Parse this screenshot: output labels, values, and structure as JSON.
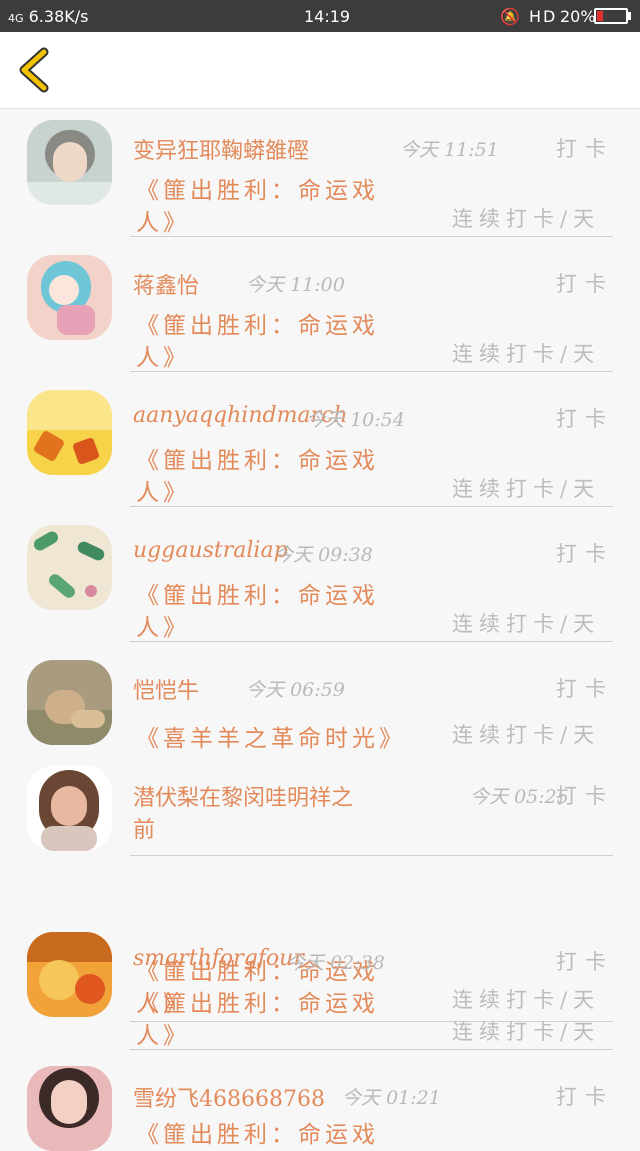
{
  "status_bar": {
    "signal": "4G",
    "speed": "6.38K/s",
    "time": "14:19",
    "icons": "🔕 HD",
    "battery": "20%",
    "battery_level": 0.2,
    "battery_color": "#e0312d"
  },
  "header": {
    "back_icon": "chevron-left-icon",
    "accent": "#f2c200"
  },
  "colors": {
    "name": "#e38a5a",
    "muted": "#bcbcbc"
  },
  "items": [
    {
      "name": "变异狂耶鞠蟒雒䃘",
      "date": "今天",
      "time": "11:51",
      "content": "《篚出胜利：命运戏",
      "content2": "人》",
      "daka": "打卡",
      "streak": "连续打卡/天"
    },
    {
      "name": "蒋鑫怡",
      "date": "今天",
      "time": "11:00",
      "content": "《篚出胜利：命运戏",
      "content2": "人》",
      "daka": "打卡",
      "streak": "连续打卡/天"
    },
    {
      "name": "aanyaqqhindmarch",
      "date": "今天",
      "time": "10:54",
      "content": "《篚出胜利：命运戏",
      "content2": "人》",
      "daka": "打卡",
      "streak": "连续打卡/天"
    },
    {
      "name": "uggaustraliap",
      "date": "今天",
      "time": "09:38",
      "content": "《篚出胜利：命运戏",
      "content2": "人》",
      "daka": "打卡",
      "streak": "连续打卡/天"
    },
    {
      "name": "恺恺牛",
      "date": "今天",
      "time": "06:59",
      "content": "《喜羊羊之革命时光》",
      "content2": "",
      "daka": "打卡",
      "streak": "连续打卡/天"
    },
    {
      "name": "潜伏梨在黎闵哇明祥之",
      "name2": "前",
      "date": "今天",
      "time": "05:25",
      "content": "《篚出胜利：命运戏",
      "content2": "人》",
      "daka": "打卡",
      "streak": "连续打卡/天"
    },
    {
      "name": "smarthforgfour",
      "date": "今天",
      "time": "02:38",
      "content": "《篚出胜利：命运戏",
      "content2": "人》",
      "daka": "打卡",
      "streak": "连续打卡/天"
    },
    {
      "name": "雪纷飞468668768",
      "date": "今天",
      "time": "01:21",
      "content": "《篚出胜利：命运戏",
      "content2": "",
      "daka": "打卡",
      "streak": ""
    }
  ]
}
